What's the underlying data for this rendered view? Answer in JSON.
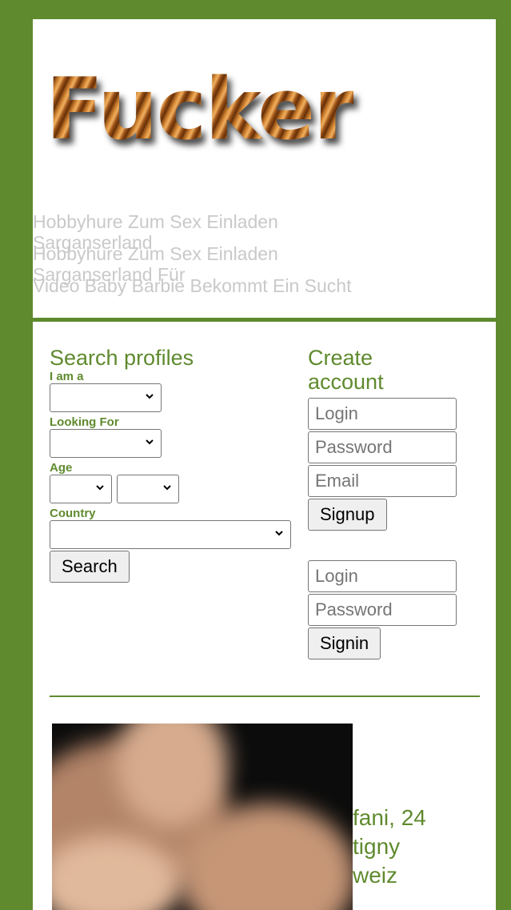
{
  "header": {
    "logo_text": "Fucker",
    "tagline_1": "Hobbyhure Zum Sex Einladen",
    "tagline_2": "Sarganserland",
    "tagline_3": "Hobbyhure Zum Sex Einladen",
    "tagline_4": "Sarganserland Für",
    "tagline_5": "Video Baby Barbie Bekommt Ein Sucht"
  },
  "search": {
    "title": "Search profiles",
    "iam_label": "I am a",
    "looking_label": "Looking For",
    "age_label": "Age",
    "country_label": "Country",
    "button_label": "Search"
  },
  "account": {
    "title_line1": "Create",
    "title_line2": "account",
    "login_placeholder": "Login",
    "password_placeholder": "Password",
    "email_placeholder": "Email",
    "signup_label": "Signup",
    "signin_login_placeholder": "Login",
    "signin_password_placeholder": "Password",
    "signin_label": "Signin"
  },
  "profile": {
    "line1": "fani, 24",
    "line2": "tigny",
    "line3": "weiz"
  },
  "colors": {
    "brand_green": "#5f8a2e",
    "tagline_gray": "#c9c9c9"
  }
}
